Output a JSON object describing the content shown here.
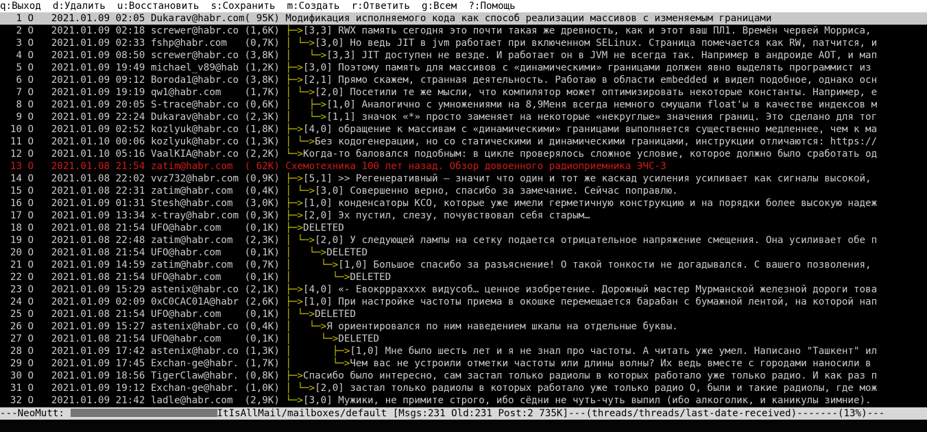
{
  "help_bar": [
    "q:Выход",
    "d:Удалить",
    "u:Восстановить",
    "s:Сохранить",
    "m:Создать",
    "r:Ответить",
    "g:Всем",
    "?:Помощь"
  ],
  "colors": {
    "tree": "#c7c400",
    "deleted_thread": "#d11a1a",
    "cursor_bg": "#c8c8c8"
  },
  "messages": [
    {
      "num": "1",
      "flag": "O",
      "date": "2021.01.09 02:05",
      "from": "Dukarav@habr.com",
      "size": "( 95K)",
      "tree": "",
      "subject": "Модификация исполняемого кода как способ реализации массивов с изменяемым границами",
      "style": "cur"
    },
    {
      "num": "2",
      "flag": "O",
      "date": "2021.01.09 02:18",
      "from": "screwer@habr.co",
      "size": "(1,6K)",
      "tree": "├─>",
      "subject": "[3,3] RWX память сегодня это почти такая же древность, как и этот ваш ПЛ1. Времён червей Морриса,",
      "style": ""
    },
    {
      "num": "3",
      "flag": "O",
      "date": "2021.01.09 02:33",
      "from": "fshp@habr.com",
      "size": "(0,7K)",
      "tree": "│ └─>",
      "subject": "[3,0] Но ведь JIT в jvm работает при включенном SELinux. Страница помечается как RW, патчится, и",
      "style": ""
    },
    {
      "num": "4",
      "flag": "O",
      "date": "2021.01.09 08:50",
      "from": "screwer@habr.co",
      "size": "(3,8K)",
      "tree": "│   └─>",
      "subject": "[3,3] JIT доступен не везде. И работает он в JVM не всегда так. Например в андроиде AOT, и мап",
      "style": ""
    },
    {
      "num": "5",
      "flag": "O",
      "date": "2021.01.09 19:49",
      "from": "michael_v89@hab",
      "size": "(1,2K)",
      "tree": "├─>",
      "subject": "[3,0] Поэтому память для массивов с «динамическими» границами должен явно выделять программист из",
      "style": ""
    },
    {
      "num": "6",
      "flag": "O",
      "date": "2021.01.09 09:12",
      "from": "Boroda1@habr.co",
      "size": "(3,8K)",
      "tree": "├─>",
      "subject": "[2,1] Прямо скажем, странная деятельность. Работаю в области embedded и видел подобное, однако осн",
      "style": ""
    },
    {
      "num": "7",
      "flag": "O",
      "date": "2021.01.09 19:19",
      "from": "qw1@habr.com",
      "size": "(1,7K)",
      "tree": "│ └─>",
      "subject": "[2,0] Посетили те же мысли, что компилятор может оптимизировать некоторые константы. Например, е",
      "style": ""
    },
    {
      "num": "8",
      "flag": "O",
      "date": "2021.01.09 20:05",
      "from": "S-trace@habr.co",
      "size": "(0,6K)",
      "tree": "│   ├─>",
      "subject": "[1,0] Аналогично с умножениями на 8,9Меня всегда немного смущали float'ы в качестве индексов м",
      "style": ""
    },
    {
      "num": "9",
      "flag": "O",
      "date": "2021.01.09 22:24",
      "from": "Dukarav@habr.co",
      "size": "(2,3K)",
      "tree": "│   └─>",
      "subject": "[1,1] значок «*» просто заменяет на некоторые «некруглые» значения границ. Это сделано для тог",
      "style": ""
    },
    {
      "num": "10",
      "flag": "O",
      "date": "2021.01.09 02:52",
      "from": "kozlyuk@habr.co",
      "size": "(1,8K)",
      "tree": "├─>",
      "subject": "[4,0] обращение к массивам с «динамическими» границами выполняется существенно медленнее, чем к ма",
      "style": ""
    },
    {
      "num": "11",
      "flag": "O",
      "date": "2021.01.10 00:06",
      "from": "kozlyuk@habr.co",
      "size": "(1,3K)",
      "tree": "│ └─>",
      "subject": "Без кодогенерации, но со статическими и динамическими границами, инструкции отличаются: https://",
      "style": ""
    },
    {
      "num": "12",
      "flag": "O",
      "date": "2021.01.10 05:16",
      "from": "VaalKIA@habr.co",
      "size": "(2,2K)",
      "tree": "└─>",
      "subject": "Когда-то баловался подобным: в цикле проверялось сложное условие, которое должно было сработать од",
      "style": ""
    },
    {
      "num": "13",
      "flag": "O",
      "date": "2021.01.08 21:54",
      "from": "zatim@habr.com",
      "size": "( 62K)",
      "tree": "",
      "subject": "Схемотехника 100 лет назад. Обзор довоенного радиоприемника ЭЧС-3",
      "style": "red"
    },
    {
      "num": "14",
      "flag": "O",
      "date": "2021.01.08 22:02",
      "from": "vvz732@habr.com",
      "size": "(0,9K)",
      "tree": "├─>",
      "subject": "[5,1] >> Регенеративный — значит что один и тот же каскад усиления усиливает как сигналы высокой,",
      "style": ""
    },
    {
      "num": "15",
      "flag": "O",
      "date": "2021.01.08 22:31",
      "from": "zatim@habr.com",
      "size": "(0,4K)",
      "tree": "│ └─>",
      "subject": "[3,0] Совершенно верно, спасибо за замечание. Сейчас поправлю.",
      "style": ""
    },
    {
      "num": "16",
      "flag": "O",
      "date": "2021.01.09 01:31",
      "from": "Stesh@habr.com",
      "size": "(3,0K)",
      "tree": "├─>",
      "subject": "[1,0] конденсаторы КСО, которые уже имели герметичную конструкцию и на порядки более высокую надеж",
      "style": ""
    },
    {
      "num": "17",
      "flag": "O",
      "date": "2021.01.09 13:34",
      "from": "x-tray@habr.com",
      "size": "(0,3K)",
      "tree": "├─>",
      "subject": "[2,0] Эх пустил, слезу, почувствовал себя старым…",
      "style": ""
    },
    {
      "num": "18",
      "flag": "O",
      "date": "2021.01.08 21:54",
      "from": "UFO@habr.com",
      "size": "(0,1K)",
      "tree": "├─>",
      "subject": "DELETED",
      "style": ""
    },
    {
      "num": "19",
      "flag": "O",
      "date": "2021.01.08 22:48",
      "from": "zatim@habr.com",
      "size": "(2,3K)",
      "tree": "│ └─>",
      "subject": "[2,0] У следующей лампы на сетку подается отрицательное напряжение смещения. Она усиливает обе п",
      "style": ""
    },
    {
      "num": "20",
      "flag": "O",
      "date": "2021.01.08 21:54",
      "from": "UFO@habr.com",
      "size": "(0,1K)",
      "tree": "│   └─>",
      "subject": "DELETED",
      "style": ""
    },
    {
      "num": "21",
      "flag": "O",
      "date": "2021.01.09 14:59",
      "from": "zatim@habr.com",
      "size": "(0,7K)",
      "tree": "│     └─>",
      "subject": "[1,0] Большое спасибо за разъяснение! О такой тонкости не догадывался. С вашего позволения,",
      "style": ""
    },
    {
      "num": "22",
      "flag": "O",
      "date": "2021.01.08 21:54",
      "from": "UFO@habr.com",
      "size": "(0,1K)",
      "tree": "│       └─>",
      "subject": "DELETED",
      "style": ""
    },
    {
      "num": "23",
      "flag": "O",
      "date": "2021.01.09 15:29",
      "from": "astenix@habr.co",
      "size": "(2,1K)",
      "tree": "├─>",
      "subject": "[4,0] «- Евокррраxxxx видусоб… ценное изобретение. Дорожный мастер Мурманской железной дороги това",
      "style": ""
    },
    {
      "num": "24",
      "flag": "O",
      "date": "2021.01.09 02:09",
      "from": "0xC0CAC01A@habr",
      "size": "(2,6K)",
      "tree": "├─>",
      "subject": "[1,0] При настройке частоты приема в окошке перемещается барабан с бумажной лентой, на которой нап",
      "style": ""
    },
    {
      "num": "25",
      "flag": "O",
      "date": "2021.01.08 21:54",
      "from": "UFO@habr.com",
      "size": "(0,1K)",
      "tree": "│ └─>",
      "subject": "DELETED",
      "style": ""
    },
    {
      "num": "26",
      "flag": "O",
      "date": "2021.01.09 15:27",
      "from": "astenix@habr.co",
      "size": "(0,4K)",
      "tree": "│   └─>",
      "subject": "Я ориентировался по ним наведением шкалы на отдельные буквы.",
      "style": ""
    },
    {
      "num": "27",
      "flag": "O",
      "date": "2021.01.08 21:54",
      "from": "UFO@habr.com",
      "size": "(0,1K)",
      "tree": "│     └─>",
      "subject": "DELETED",
      "style": ""
    },
    {
      "num": "28",
      "flag": "O",
      "date": "2021.01.09 17:42",
      "from": "astenix@habr.co",
      "size": "(1,3K)",
      "tree": "│       ├─>",
      "subject": "[1,0] Мне было шесть лет и я не знал про частоты. А читать уже умел. Написано \"Ташкент\" ил",
      "style": ""
    },
    {
      "num": "29",
      "flag": "O",
      "date": "2021.01.09 17:45",
      "from": "Exchan-ge@habr.",
      "size": "(1,7K)",
      "tree": "│       └─>",
      "subject": "Чем вас не устроили отметки частоты или длины волны? Их ведь вместе с городами наносили в",
      "style": ""
    },
    {
      "num": "30",
      "flag": "O",
      "date": "2021.01.09 18:56",
      "from": "TigerClaw@habr.",
      "size": "(0,8K)",
      "tree": "├─>",
      "subject": "Спасибо было интересно, сам застал только радиолы в которых работало уже только радио. И как раз п",
      "style": ""
    },
    {
      "num": "31",
      "flag": "O",
      "date": "2021.01.09 19:12",
      "from": "Exchan-ge@habr.",
      "size": "(1,0K)",
      "tree": "│ └─>",
      "subject": "[2,0] застал только радиолы в которых работало уже только радио О, были и такие радиолы, где мож",
      "style": ""
    },
    {
      "num": "32",
      "flag": "O",
      "date": "2021.01.09 21:42",
      "from": "ladle@habr.com",
      "size": "(2,9K)",
      "tree": "└─>",
      "subject": "[3,0] Мужики, не примите строго, ибо сёдни не чуть-чуть выпил (ибо алкоголик, и каникулы зимние).",
      "style": ""
    }
  ],
  "status_bar": {
    "prefix": "---NeoMutt: ",
    "suffix": "ItIsAllMail/mailboxes/default [Msgs:231 Old:231 Post:2 735K]---(threads/threads/last-date-received)-------(13%)---"
  }
}
